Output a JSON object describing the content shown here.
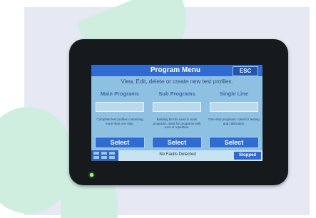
{
  "program_menu": {
    "title": "Program Menu",
    "esc_label": "ESC",
    "subtitle": "View, Edit, delete or create new test profiles.",
    "columns": [
      {
        "heading": "Main Programs",
        "field_value": "",
        "description": "Complete test profiles containing more than one step.",
        "select_label": "Select"
      },
      {
        "heading": "Sub Programs",
        "field_value": "",
        "description": "Building blocks used in main programs; ideal for programs with runs of repetition.",
        "select_label": "Select"
      },
      {
        "heading": "Single Line",
        "field_value": "",
        "description": "One step programs. Ideal for testing and calibration.",
        "select_label": "Select"
      }
    ]
  },
  "status_bar": {
    "message": "No Faults Detected",
    "state": "Stopped"
  },
  "colors": {
    "accent": "#2f6bd0",
    "screen_bg": "#8ec0e2",
    "led": "#9bff6e"
  }
}
